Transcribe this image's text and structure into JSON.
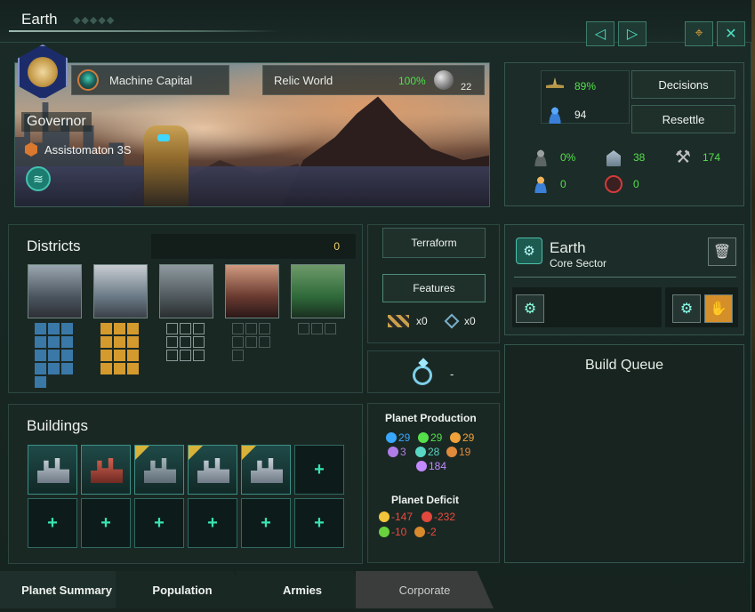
{
  "window": {
    "title": "Earth"
  },
  "header": {
    "designation": "Machine Capital",
    "planet_class": "Relic World",
    "habitability": "100%",
    "planet_size": "22",
    "governor_label": "Governor",
    "governor_name": "Assistomaton 3S"
  },
  "stats": {
    "stability": "89%",
    "pops": "94",
    "unemployment": "0%",
    "housing": "38",
    "jobs": "174",
    "workers": "0",
    "free_slots": "0",
    "decisions_label": "Decisions",
    "resettle_label": "Resettle"
  },
  "districts": {
    "title": "Districts",
    "count": "0"
  },
  "center": {
    "terraform_label": "Terraform",
    "features_label": "Features",
    "blocker_count": "x0",
    "feature_count": "x0",
    "special_value": "-"
  },
  "production": {
    "title": "Planet Production",
    "items": [
      {
        "icon": "research-icon",
        "value": "29",
        "color": "#39a7ff"
      },
      {
        "icon": "society-icon",
        "value": "29",
        "color": "#55e04b"
      },
      {
        "icon": "engineering-icon",
        "value": "29",
        "color": "#f0a23a"
      },
      {
        "icon": "unity-icon",
        "value": "3",
        "color": "#b07de8"
      },
      {
        "icon": "alloys-icon",
        "value": "28",
        "color": "#58d6c2"
      },
      {
        "icon": "consumer-goods-icon",
        "value": "19",
        "color": "#e08a3c"
      },
      {
        "icon": "influence-icon",
        "value": "184",
        "color": "#c389ff"
      }
    ]
  },
  "deficit": {
    "title": "Planet Deficit",
    "items": [
      {
        "icon": "energy-icon",
        "value": "-147"
      },
      {
        "icon": "minerals-icon",
        "value": "-232"
      },
      {
        "icon": "food-icon",
        "value": "-10"
      },
      {
        "icon": "strategic-icon",
        "value": "-2"
      }
    ]
  },
  "buildings": {
    "title": "Buildings"
  },
  "sector": {
    "name": "Earth",
    "type": "Core Sector"
  },
  "build_queue": {
    "title": "Build Queue"
  },
  "tabs": [
    {
      "label": "Planet Summary"
    },
    {
      "label": "Population"
    },
    {
      "label": "Armies"
    },
    {
      "label": "Corporate"
    }
  ],
  "colors": {
    "accent": "#38e3b4",
    "positive": "#55e04b",
    "negative": "#ee4a3c",
    "highlight": "#f3d36a"
  }
}
